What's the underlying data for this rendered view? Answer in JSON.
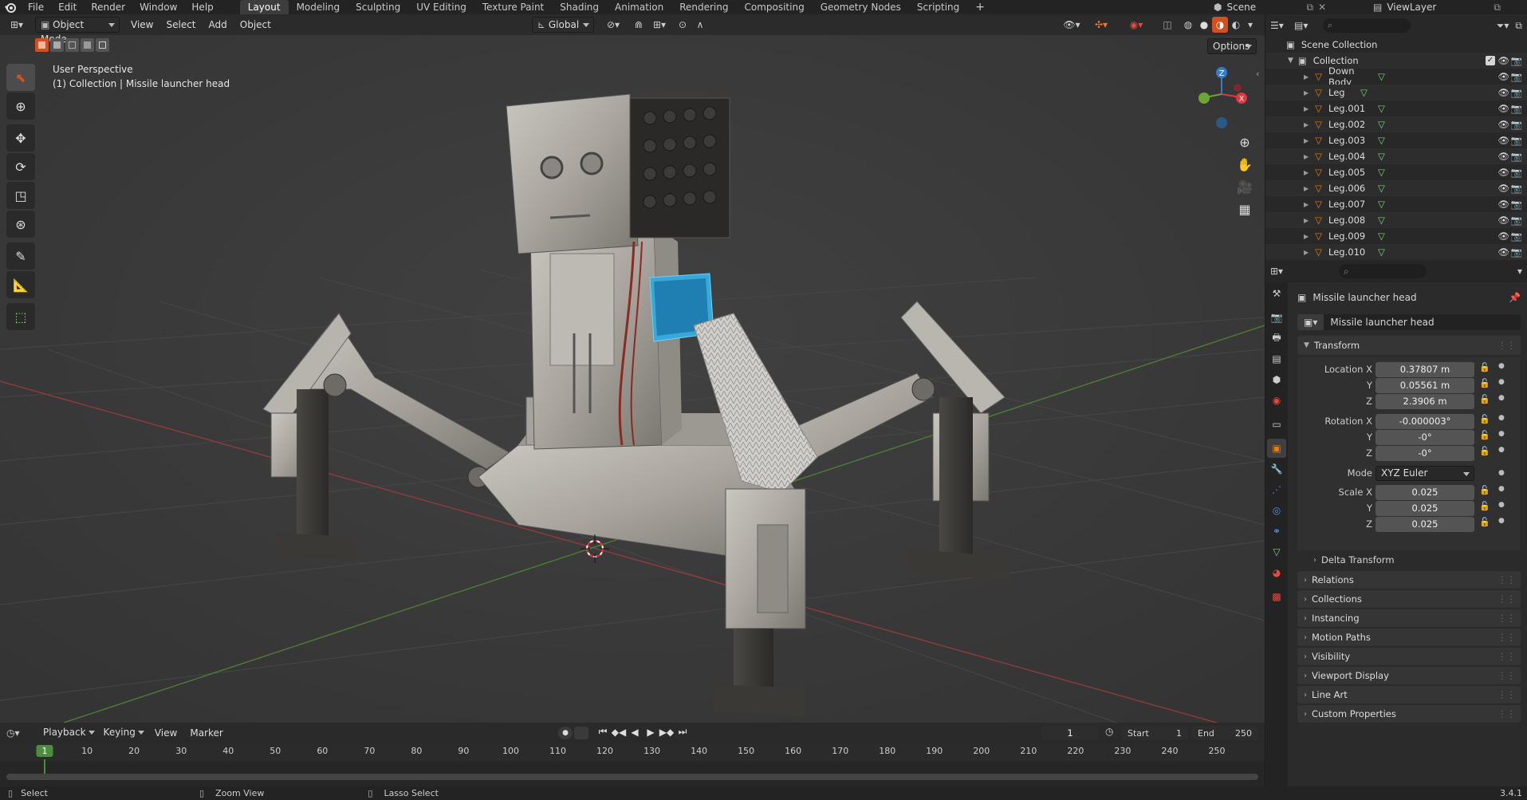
{
  "topbar": {
    "menus": [
      "File",
      "Edit",
      "Render",
      "Window",
      "Help"
    ],
    "workspaces": [
      "Layout",
      "Modeling",
      "Sculpting",
      "UV Editing",
      "Texture Paint",
      "Shading",
      "Animation",
      "Rendering",
      "Compositing",
      "Geometry Nodes",
      "Scripting"
    ],
    "active_workspace": "Layout",
    "scene": "Scene",
    "view_layer": "ViewLayer"
  },
  "viewport": {
    "mode": "Object Mode",
    "menus": [
      "View",
      "Select",
      "Add",
      "Object"
    ],
    "orientation": "Global",
    "options": "Options",
    "perspective": "User Perspective",
    "context": "(1) Collection | Missile launcher head",
    "gizmo": {
      "x": "X",
      "y": "Y",
      "z": "Z"
    }
  },
  "outliner": {
    "root": "Scene Collection",
    "collection": "Collection",
    "objects": [
      "Down Body",
      "Leg",
      "Leg.001",
      "Leg.002",
      "Leg.003",
      "Leg.004",
      "Leg.005",
      "Leg.006",
      "Leg.007",
      "Leg.008",
      "Leg.009",
      "Leg.010"
    ]
  },
  "properties": {
    "object_name": "Missile launcher head",
    "datablock": "Missile launcher head",
    "transform": {
      "title": "Transform",
      "location_label": "Location X",
      "location": [
        "0.37807 m",
        "0.05561 m",
        "2.3906 m"
      ],
      "rotation_label": "Rotation X",
      "rotation": [
        "-0.000003°",
        "-0°",
        "-0°"
      ],
      "mode_label": "Mode",
      "mode": "XYZ Euler",
      "scale_label": "Scale X",
      "scale": [
        "0.025",
        "0.025",
        "0.025"
      ],
      "axis_y": "Y",
      "axis_z": "Z"
    },
    "delta": "Delta Transform",
    "panels": [
      "Relations",
      "Collections",
      "Instancing",
      "Motion Paths",
      "Visibility",
      "Viewport Display",
      "Line Art",
      "Custom Properties"
    ]
  },
  "timeline": {
    "menus": [
      "Playback",
      "Keying",
      "View",
      "Marker"
    ],
    "current_frame": "1",
    "start_label": "Start",
    "start": "1",
    "end_label": "End",
    "end": "250",
    "ticks": [
      "1",
      "10",
      "20",
      "30",
      "40",
      "50",
      "60",
      "70",
      "80",
      "90",
      "100",
      "110",
      "120",
      "130",
      "140",
      "150",
      "160",
      "170",
      "180",
      "190",
      "200",
      "210",
      "220",
      "230",
      "240",
      "250"
    ]
  },
  "statusbar": {
    "select": "Select",
    "zoom": "Zoom View",
    "lasso": "Lasso Select",
    "version": "3.4.1"
  },
  "colors": {
    "accent": "#e87d0d",
    "active_tool": "#d3501e",
    "frame_marker": "#4b8f3c",
    "x_axis": "#e2353f",
    "y_axis": "#6aa535",
    "z_axis": "#2e7fd4"
  }
}
